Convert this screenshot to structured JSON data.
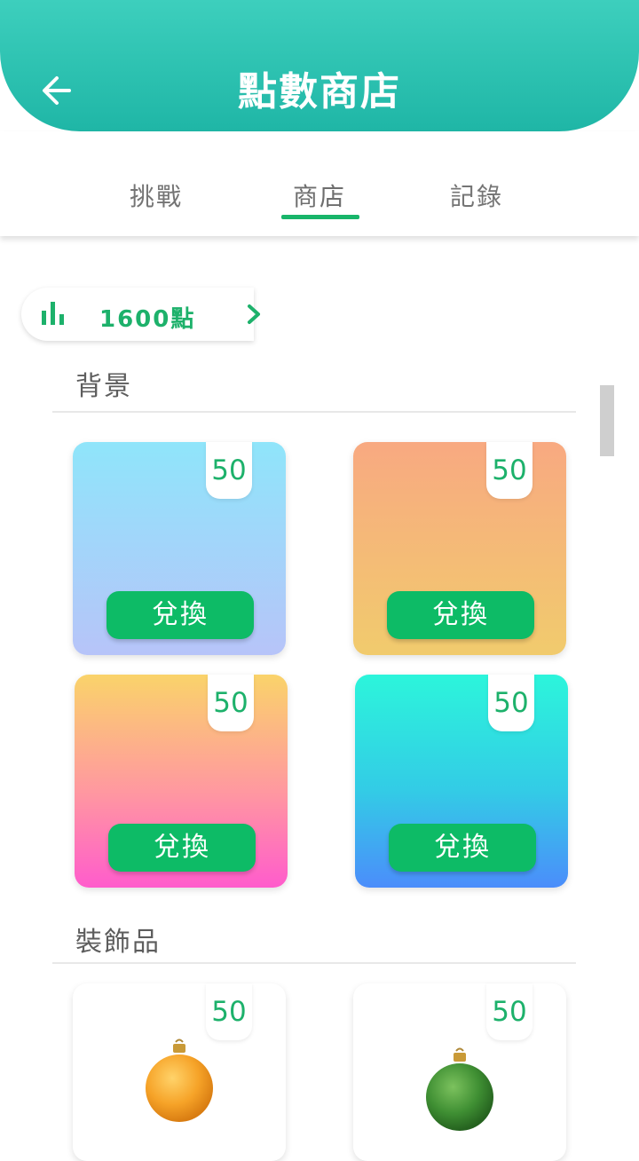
{
  "header": {
    "title": "點數商店",
    "back_icon": "arrow-left-icon"
  },
  "tabs": [
    {
      "label": "挑戰",
      "active": false
    },
    {
      "label": "商店",
      "active": true
    },
    {
      "label": "記錄",
      "active": false
    }
  ],
  "points": {
    "value_label": "1600點",
    "icon": "bar-chart-icon",
    "chevron": "chevron-right-icon"
  },
  "sections": {
    "backgrounds": {
      "title": "背景",
      "items": [
        {
          "price": "50",
          "button": "兌換",
          "gradient": [
            "#8fe5fa",
            "#b7c4f9"
          ]
        },
        {
          "price": "50",
          "button": "兌換",
          "gradient": [
            "#f8a981",
            "#f1cb6d"
          ]
        },
        {
          "price": "50",
          "button": "兌換",
          "gradient": [
            "#fad36a",
            "#ff5ccc"
          ]
        },
        {
          "price": "50",
          "button": "兌換",
          "gradient": [
            "#2cf5db",
            "#4b8dfb"
          ]
        }
      ]
    },
    "decorations": {
      "title": "裝飾品",
      "items": [
        {
          "price": "50",
          "icon": "orange-ornament-icon"
        },
        {
          "price": "50",
          "icon": "green-ornament-icon"
        }
      ]
    }
  },
  "colors": {
    "accent": "#1db16b",
    "header": "#2cc4b2",
    "button": "#0dbb66"
  }
}
